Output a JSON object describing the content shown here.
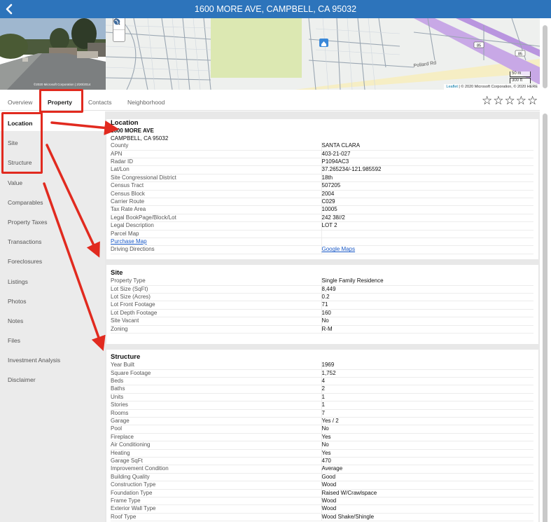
{
  "header": {
    "title": "1600 MORE AVE, CAMPBELL, CA 95032",
    "back_icon": "chevron-left-icon"
  },
  "photo": {
    "credit": "©2020 Microsoft Corporation | 2/20/2014"
  },
  "map": {
    "labels": [
      "Pollard Rd",
      "85",
      "85"
    ],
    "scale_m": "50 m",
    "scale_ft": "300 ft",
    "attribution_leaflet": "Leaflet",
    "attribution_rest": " | © 2020 Microsoft Corporation, © 2020 HERE"
  },
  "tabs": [
    {
      "label": "Overview"
    },
    {
      "label": "Property",
      "active": true
    },
    {
      "label": "Contacts"
    },
    {
      "label": "Neighborhood"
    }
  ],
  "rating": {
    "stars": [
      "☆",
      "☆",
      "☆",
      "☆",
      "☆"
    ]
  },
  "sidebar": {
    "items": [
      {
        "label": "Location",
        "active": true
      },
      {
        "label": "Site"
      },
      {
        "label": "Structure"
      },
      {
        "label": "Value"
      },
      {
        "label": "Comparables"
      },
      {
        "label": "Property Taxes"
      },
      {
        "label": "Transactions"
      },
      {
        "label": "Foreclosures"
      },
      {
        "label": "Listings"
      },
      {
        "label": "Photos"
      },
      {
        "label": "Notes"
      },
      {
        "label": "Files"
      },
      {
        "label": "Investment Analysis"
      },
      {
        "label": "Disclaimer"
      }
    ]
  },
  "location": {
    "title": "Location",
    "address_line1": "1600 MORE AVE",
    "address_line2": "CAMPBELL, CA 95032",
    "rows": [
      {
        "k": "County",
        "v": "SANTA CLARA"
      },
      {
        "k": "APN",
        "v": "403-21-027"
      },
      {
        "k": "Radar ID",
        "v": "P1094AC3"
      },
      {
        "k": "Lat/Lon",
        "v": "37.265234/-121.985592"
      },
      {
        "k": "Site Congressional District",
        "v": "18th"
      },
      {
        "k": "Census Tract",
        "v": "507205"
      },
      {
        "k": "Census Block",
        "v": "2004"
      },
      {
        "k": "Carrier Route",
        "v": "C029"
      },
      {
        "k": "Tax Rate Area",
        "v": "10005"
      },
      {
        "k": "Legal BookPage/Block/Lot",
        "v": "242 38//2"
      },
      {
        "k": "Legal Description",
        "v": "LOT 2"
      },
      {
        "k": "Parcel Map",
        "v": ""
      },
      {
        "k": "Purchase Map",
        "v": "",
        "klink": true
      },
      {
        "k": "Driving Directions",
        "v": "Google Maps",
        "vlink": true
      }
    ]
  },
  "site": {
    "title": "Site",
    "rows": [
      {
        "k": "Property Type",
        "v": "Single Family Residence"
      },
      {
        "k": "Lot Size (SqFt)",
        "v": "8,449"
      },
      {
        "k": "Lot Size (Acres)",
        "v": "0.2"
      },
      {
        "k": "Lot Front Footage",
        "v": "71"
      },
      {
        "k": "Lot Depth Footage",
        "v": "160"
      },
      {
        "k": "Site Vacant",
        "v": "No"
      },
      {
        "k": "Zoning",
        "v": "R-M"
      }
    ]
  },
  "structure": {
    "title": "Structure",
    "rows": [
      {
        "k": "Year Built",
        "v": "1969"
      },
      {
        "k": "Square Footage",
        "v": "1,752"
      },
      {
        "k": "Beds",
        "v": "4"
      },
      {
        "k": "Baths",
        "v": "2"
      },
      {
        "k": "Units",
        "v": "1"
      },
      {
        "k": "Stories",
        "v": "1"
      },
      {
        "k": "Rooms",
        "v": "7"
      },
      {
        "k": "Garage",
        "v": "Yes / 2"
      },
      {
        "k": "Pool",
        "v": "No"
      },
      {
        "k": "Fireplace",
        "v": "Yes"
      },
      {
        "k": "Air Conditioning",
        "v": "No"
      },
      {
        "k": "Heating",
        "v": "Yes"
      },
      {
        "k": "Garage SqFt",
        "v": "470"
      },
      {
        "k": "Improvement Condition",
        "v": "Average"
      },
      {
        "k": "Building Quality",
        "v": "Good"
      },
      {
        "k": "Construction Type",
        "v": "Wood"
      },
      {
        "k": "Foundation Type",
        "v": "Raised W/Crawlspace"
      },
      {
        "k": "Frame Type",
        "v": "Wood"
      },
      {
        "k": "Exterior Wall Type",
        "v": "Wood"
      },
      {
        "k": "Roof Type",
        "v": "Wood Shake/Shingle"
      }
    ]
  },
  "colors": {
    "header": "#2d74bb",
    "annotation": "#e12a1f",
    "link": "#1a59c6"
  }
}
